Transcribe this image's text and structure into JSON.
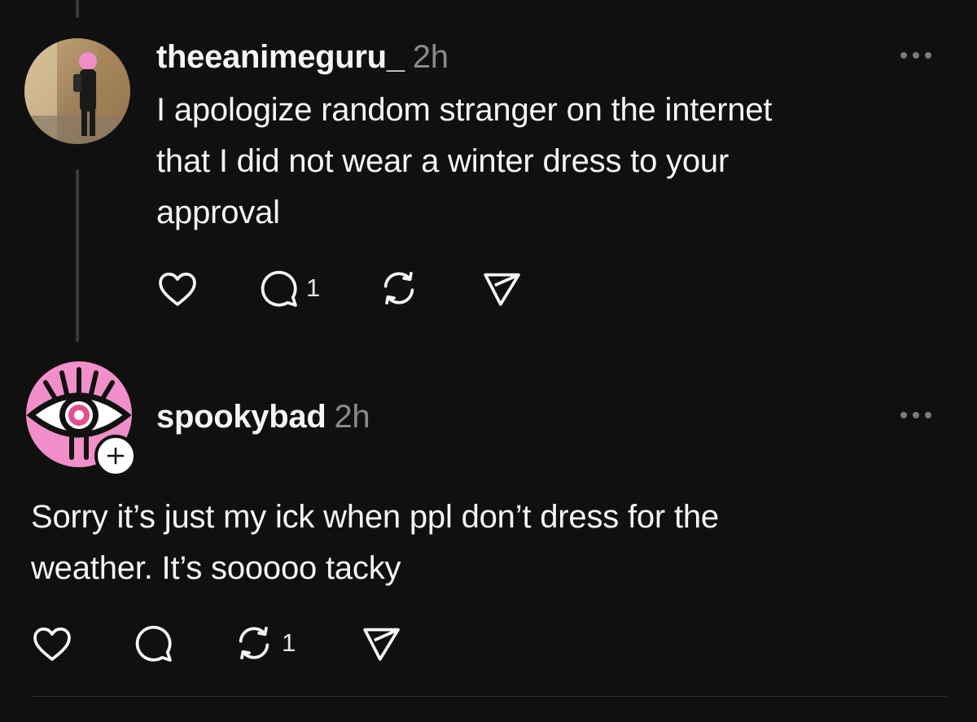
{
  "thread": [
    {
      "username": "theeanimeguru_",
      "timestamp": "2h",
      "text": "I apologize random stranger on the internet\nthat I did not wear a winter dress to your\napproval",
      "counts": {
        "likes": "",
        "replies": "1",
        "reposts": "",
        "shares": ""
      },
      "icons": {
        "avatar": "user-photo-avatar",
        "more": "more-options-icon"
      }
    },
    {
      "username": "spookybad",
      "timestamp": "2h",
      "text": "Sorry it’s just my ick when ppl don’t dress for the\nweather. It’s sooooo tacky",
      "counts": {
        "likes": "",
        "replies": "",
        "reposts": "1",
        "shares": ""
      },
      "icons": {
        "avatar": "pink-eye-avatar",
        "follow": "plus-icon",
        "more": "more-options-icon"
      }
    }
  ],
  "colors": {
    "background": "#101010",
    "text": "#f3f5f7",
    "muted": "#8a8a8e",
    "thread_line": "#3a3a3c",
    "avatar_pink": "#f08fc9"
  }
}
